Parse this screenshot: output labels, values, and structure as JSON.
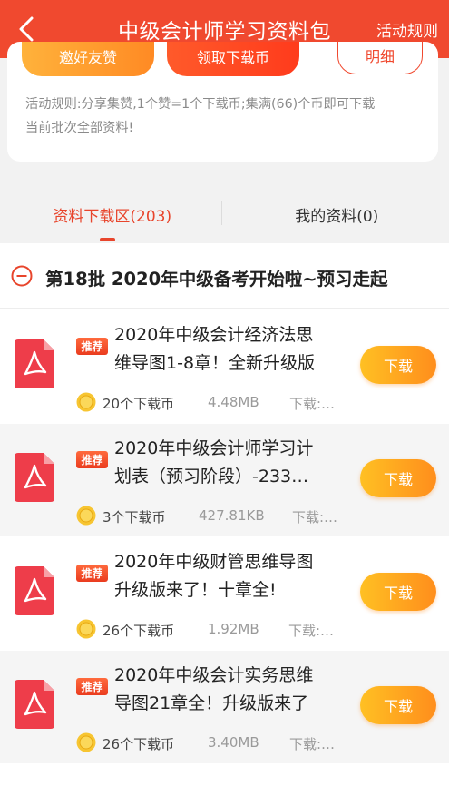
{
  "header": {
    "title": "中级会计师学习资料包",
    "rules_link": "活动规则"
  },
  "top_card": {
    "share_button": "邀好友赞",
    "get_button": "领取下载币",
    "detail_button": "明细",
    "rules_line1": "活动规则:分享集赞,1个赞=1个下载币;集满(66)个币即可下载",
    "rules_line2": "当前批次全部资料!"
  },
  "tabs": {
    "download_area": "资料下载区(203)",
    "my_materials": "我的资料(0)"
  },
  "section": {
    "title": "第18批 2020年中级备考开始啦~预习走起"
  },
  "items": [
    {
      "badge": "推荐",
      "title1": "2020年中级会计经济法思",
      "title2": "维导图1-8章！全新升级版",
      "coins": "20个下载币",
      "size": "4.48MB",
      "downloads": "下载:…",
      "button": "下载"
    },
    {
      "badge": "推荐",
      "title1": "2020年中级会计师学习计",
      "title2": "划表（预习阶段）-233…",
      "coins": "3个下载币",
      "size": "427.81KB",
      "downloads": "下载:…",
      "button": "下载"
    },
    {
      "badge": "推荐",
      "title1": "2020年中级财管思维导图",
      "title2": "升级版来了！十章全!",
      "coins": "26个下载币",
      "size": "1.92MB",
      "downloads": "下载:…",
      "button": "下载"
    },
    {
      "badge": "推荐",
      "title1": "2020年中级会计实务思维",
      "title2": "导图21章全！升级版来了",
      "coins": "26个下载币",
      "size": "3.40MB",
      "downloads": "下载:…",
      "button": "下载"
    }
  ],
  "colors": {
    "brand": "#f0492f",
    "download_button": "#ff9f1f",
    "badge": "#ea3c1f"
  }
}
